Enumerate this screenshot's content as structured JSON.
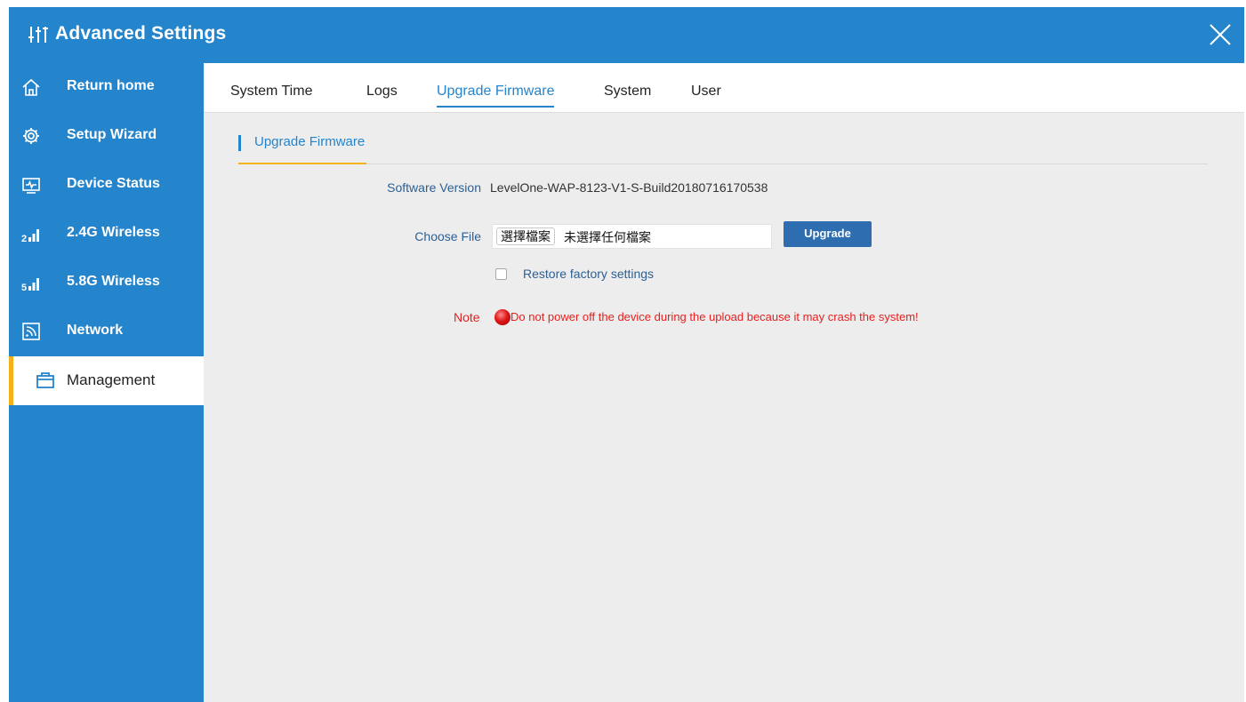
{
  "window": {
    "title": "Advanced Settings"
  },
  "sidebar": {
    "items": [
      {
        "label": "Return home",
        "icon": "home-icon"
      },
      {
        "label": "Setup Wizard",
        "icon": "gear-icon"
      },
      {
        "label": "Device Status",
        "icon": "monitor-icon"
      },
      {
        "label": "2.4G Wireless",
        "icon": "signal-2g-icon"
      },
      {
        "label": "5.8G Wireless",
        "icon": "signal-5g-icon"
      },
      {
        "label": "Network",
        "icon": "network-icon"
      },
      {
        "label": "Management",
        "icon": "briefcase-icon",
        "active": true
      }
    ]
  },
  "tabs": [
    {
      "label": "System Time"
    },
    {
      "label": "Logs"
    },
    {
      "label": "Upgrade Firmware",
      "active": true
    },
    {
      "label": "System"
    },
    {
      "label": "User"
    }
  ],
  "section": {
    "title": "Upgrade Firmware"
  },
  "form": {
    "software_version_label": "Software Version",
    "software_version_value": "LevelOne-WAP-8123-V1-S-Build20180716170538",
    "choose_file_label": "Choose File",
    "choose_file_button": "選擇檔案",
    "no_file_text": "未選擇任何檔案",
    "upgrade_button": "Upgrade",
    "restore_label": "Restore factory settings",
    "restore_checked": false,
    "note_label": "Note",
    "note_text": "Do not power off the device during the upload because it may crash the system!"
  },
  "colors": {
    "primary": "#2484cc",
    "accent": "#f5b11a",
    "warning": "#e62020",
    "button": "#2e6db0"
  }
}
